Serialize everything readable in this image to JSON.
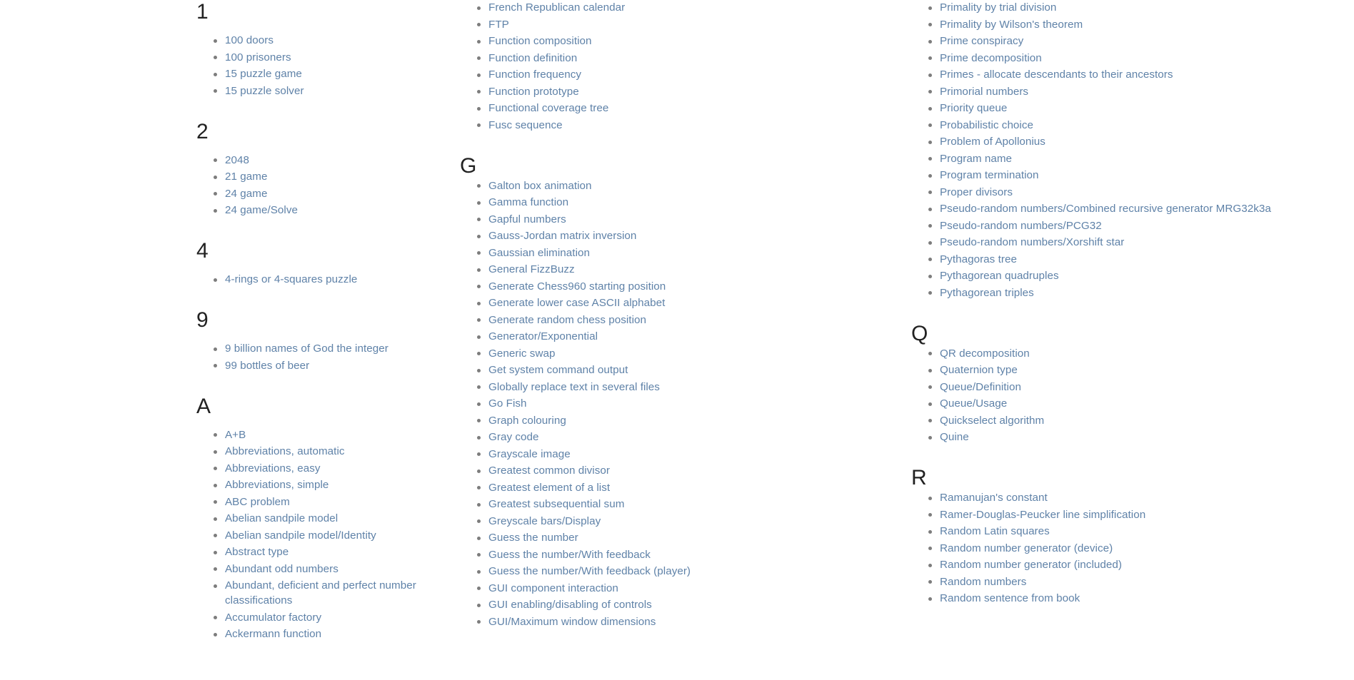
{
  "page": {
    "kind": "category-index",
    "title": "Programming Tasks Index",
    "background_color": "#ffffff",
    "link_color": "#5f82a8",
    "heading_color": "#222222",
    "bullet_color": "#7d7d7d"
  },
  "columns": [
    {
      "id": "column-1",
      "groups": [
        {
          "heading": "1",
          "items": [
            "100 doors",
            "100 prisoners",
            "15 puzzle game",
            "15 puzzle solver"
          ]
        },
        {
          "heading": "2",
          "items": [
            "2048",
            "21 game",
            "24 game",
            "24 game/Solve"
          ]
        },
        {
          "heading": "4",
          "items": [
            "4-rings or 4-squares puzzle"
          ]
        },
        {
          "heading": "9",
          "items": [
            "9 billion names of God the integer",
            "99 bottles of beer"
          ]
        },
        {
          "heading": "A",
          "items": [
            "A+B",
            "Abbreviations, automatic",
            "Abbreviations, easy",
            "Abbreviations, simple",
            "ABC problem",
            "Abelian sandpile model",
            "Abelian sandpile model/Identity",
            "Abstract type",
            "Abundant odd numbers",
            "Abundant, deficient and perfect number classifications",
            "Accumulator factory",
            "Ackermann function"
          ]
        }
      ]
    },
    {
      "id": "column-2",
      "continuation": true,
      "groups": [
        {
          "heading": null,
          "items": [
            "French Republican calendar",
            "FTP",
            "Function composition",
            "Function definition",
            "Function frequency",
            "Function prototype",
            "Functional coverage tree",
            "Fusc sequence"
          ]
        },
        {
          "heading": "G",
          "items": [
            "Galton box animation",
            "Gamma function",
            "Gapful numbers",
            "Gauss-Jordan matrix inversion",
            "Gaussian elimination",
            "General FizzBuzz",
            "Generate Chess960 starting position",
            "Generate lower case ASCII alphabet",
            "Generate random chess position",
            "Generator/Exponential",
            "Generic swap",
            "Get system command output",
            "Globally replace text in several files",
            "Go Fish",
            "Graph colouring",
            "Gray code",
            "Grayscale image",
            "Greatest common divisor",
            "Greatest element of a list",
            "Greatest subsequential sum",
            "Greyscale bars/Display",
            "Guess the number",
            "Guess the number/With feedback",
            "Guess the number/With feedback (player)",
            "GUI component interaction",
            "GUI enabling/disabling of controls",
            "GUI/Maximum window dimensions"
          ]
        }
      ]
    },
    {
      "id": "column-3",
      "continuation": true,
      "groups": [
        {
          "heading": null,
          "items": [
            "Primality by trial division",
            "Primality by Wilson's theorem",
            "Prime conspiracy",
            "Prime decomposition",
            "Primes - allocate descendants to their ancestors",
            "Primorial numbers",
            "Priority queue",
            "Probabilistic choice",
            "Problem of Apollonius",
            "Program name",
            "Program termination",
            "Proper divisors",
            "Pseudo-random numbers/Combined recursive generator MRG32k3a",
            "Pseudo-random numbers/PCG32",
            "Pseudo-random numbers/Xorshift star",
            "Pythagoras tree",
            "Pythagorean quadruples",
            "Pythagorean triples"
          ]
        },
        {
          "heading": "Q",
          "items": [
            "QR decomposition",
            "Quaternion type",
            "Queue/Definition",
            "Queue/Usage",
            "Quickselect algorithm",
            "Quine"
          ]
        },
        {
          "heading": "R",
          "items": [
            "Ramanujan's constant",
            "Ramer-Douglas-Peucker line simplification",
            "Random Latin squares",
            "Random number generator (device)",
            "Random number generator (included)",
            "Random numbers",
            "Random sentence from book"
          ]
        }
      ]
    }
  ]
}
